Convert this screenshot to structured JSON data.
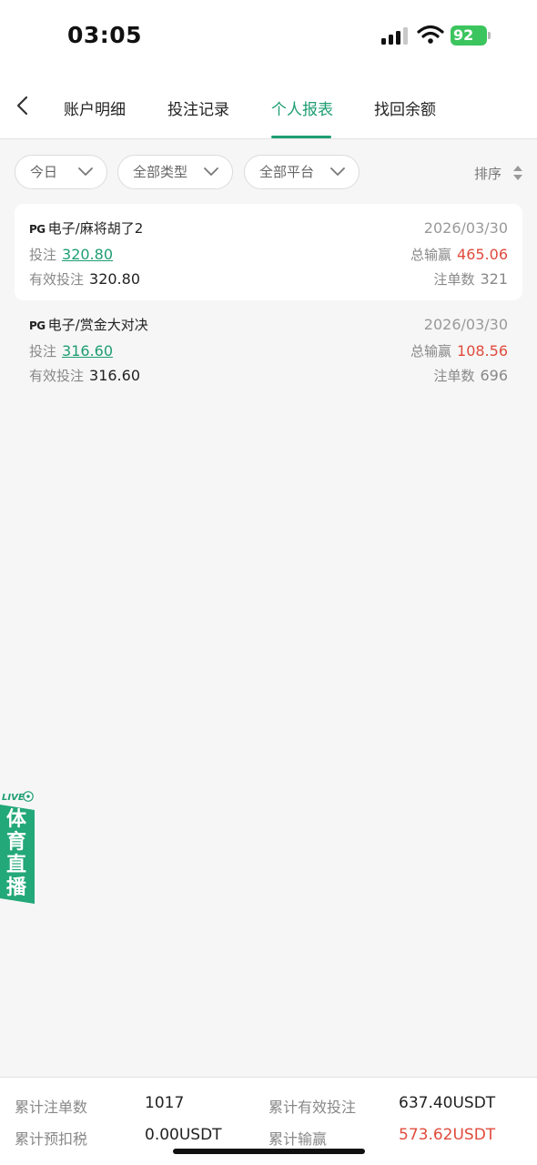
{
  "status_bar": {
    "time": "03:05",
    "battery": "92"
  },
  "nav": {
    "back_icon": "chevron-left-icon",
    "tabs": [
      {
        "label": "账户明细"
      },
      {
        "label": "投注记录"
      },
      {
        "label": "个人报表"
      },
      {
        "label": "找回余额"
      }
    ],
    "active_tab": 2
  },
  "filters": {
    "date": "今日",
    "type": "全部类型",
    "platform": "全部平台",
    "sort": "排序"
  },
  "records": [
    {
      "brand": "PG",
      "title": "电子/麻将胡了2",
      "date": "2026/03/30",
      "bet_label": "投注",
      "bet": "320.80",
      "win_label": "总输赢",
      "win": "465.06",
      "valid_label": "有效投注",
      "valid": "320.80",
      "count_label": "注单数",
      "count": "321"
    },
    {
      "brand": "PG",
      "title": "电子/赏金大对决",
      "date": "2026/03/30",
      "bet_label": "投注",
      "bet": "316.60",
      "win_label": "总输赢",
      "win": "108.56",
      "valid_label": "有效投注",
      "valid": "316.60",
      "count_label": "注单数",
      "count": "696"
    }
  ],
  "live_badge": {
    "tag": "LIVE",
    "chars": [
      "体",
      "育",
      "直",
      "播"
    ]
  },
  "summary": {
    "total_count_label": "累计注单数",
    "total_count": "1017",
    "total_valid_label": "累计有效投注",
    "total_valid": "637.40USDT",
    "total_tax_label": "累计预扣税",
    "total_tax": "0.00USDT",
    "total_win_label": "累计输赢",
    "total_win": "573.62USDT"
  },
  "colors": {
    "accent": "#1e9e72",
    "negative": "#e04b3c",
    "battery": "#3cc55e"
  }
}
